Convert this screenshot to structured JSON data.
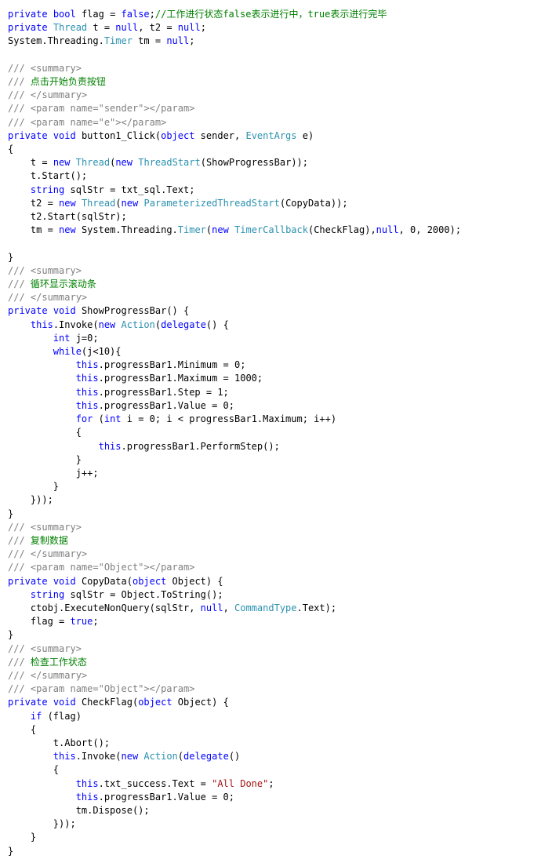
{
  "editor": {
    "language": "csharp",
    "background": "#ffffff",
    "colors": {
      "keyword": "#0000ff",
      "type": "#2b91af",
      "string": "#a31515",
      "comment": "#008000",
      "doc_comment": "#808080",
      "plain": "#000000"
    }
  },
  "code": {
    "lines": [
      {
        "indent": 0,
        "tokens": [
          {
            "t": "kw",
            "s": "private"
          },
          {
            "t": "plain",
            "s": " "
          },
          {
            "t": "kw",
            "s": "bool"
          },
          {
            "t": "plain",
            "s": " flag = "
          },
          {
            "t": "kw",
            "s": "false"
          },
          {
            "t": "plain",
            "s": ";"
          },
          {
            "t": "cmt",
            "s": "//工作进行状态false表示进行中，true表示进行完毕"
          }
        ]
      },
      {
        "indent": 0,
        "tokens": [
          {
            "t": "kw",
            "s": "private"
          },
          {
            "t": "plain",
            "s": " "
          },
          {
            "t": "type",
            "s": "Thread"
          },
          {
            "t": "plain",
            "s": " t = "
          },
          {
            "t": "kw",
            "s": "null"
          },
          {
            "t": "plain",
            "s": ", t2 = "
          },
          {
            "t": "kw",
            "s": "null"
          },
          {
            "t": "plain",
            "s": ";"
          }
        ]
      },
      {
        "indent": 0,
        "tokens": [
          {
            "t": "plain",
            "s": "System.Threading."
          },
          {
            "t": "type",
            "s": "Timer"
          },
          {
            "t": "plain",
            "s": " tm = "
          },
          {
            "t": "kw",
            "s": "null"
          },
          {
            "t": "plain",
            "s": ";"
          }
        ]
      },
      {
        "indent": 0,
        "tokens": []
      },
      {
        "indent": 0,
        "tokens": [
          {
            "t": "doc",
            "s": "/// <summary>"
          }
        ]
      },
      {
        "indent": 0,
        "tokens": [
          {
            "t": "doc",
            "s": "/// "
          },
          {
            "t": "cmt",
            "s": "点击开始负责按钮"
          }
        ]
      },
      {
        "indent": 0,
        "tokens": [
          {
            "t": "doc",
            "s": "/// </summary>"
          }
        ]
      },
      {
        "indent": 0,
        "tokens": [
          {
            "t": "doc",
            "s": "/// <param name=\"sender\"></param>"
          }
        ]
      },
      {
        "indent": 0,
        "tokens": [
          {
            "t": "doc",
            "s": "/// <param name=\"e\"></param>"
          }
        ]
      },
      {
        "indent": 0,
        "tokens": [
          {
            "t": "kw",
            "s": "private"
          },
          {
            "t": "plain",
            "s": " "
          },
          {
            "t": "kw",
            "s": "void"
          },
          {
            "t": "plain",
            "s": " button1_Click("
          },
          {
            "t": "kw",
            "s": "object"
          },
          {
            "t": "plain",
            "s": " sender, "
          },
          {
            "t": "type",
            "s": "EventArgs"
          },
          {
            "t": "plain",
            "s": " e)"
          }
        ]
      },
      {
        "indent": 0,
        "tokens": [
          {
            "t": "plain",
            "s": "{"
          }
        ]
      },
      {
        "indent": 1,
        "tokens": [
          {
            "t": "plain",
            "s": "t = "
          },
          {
            "t": "kw",
            "s": "new"
          },
          {
            "t": "plain",
            "s": " "
          },
          {
            "t": "type",
            "s": "Thread"
          },
          {
            "t": "plain",
            "s": "("
          },
          {
            "t": "kw",
            "s": "new"
          },
          {
            "t": "plain",
            "s": " "
          },
          {
            "t": "type",
            "s": "ThreadStart"
          },
          {
            "t": "plain",
            "s": "(ShowProgressBar));"
          }
        ]
      },
      {
        "indent": 1,
        "tokens": [
          {
            "t": "plain",
            "s": "t.Start();"
          }
        ]
      },
      {
        "indent": 1,
        "tokens": [
          {
            "t": "kw",
            "s": "string"
          },
          {
            "t": "plain",
            "s": " sqlStr = txt_sql.Text;"
          }
        ]
      },
      {
        "indent": 1,
        "tokens": [
          {
            "t": "plain",
            "s": "t2 = "
          },
          {
            "t": "kw",
            "s": "new"
          },
          {
            "t": "plain",
            "s": " "
          },
          {
            "t": "type",
            "s": "Thread"
          },
          {
            "t": "plain",
            "s": "("
          },
          {
            "t": "kw",
            "s": "new"
          },
          {
            "t": "plain",
            "s": " "
          },
          {
            "t": "type",
            "s": "ParameterizedThreadStart"
          },
          {
            "t": "plain",
            "s": "(CopyData));"
          }
        ]
      },
      {
        "indent": 1,
        "tokens": [
          {
            "t": "plain",
            "s": "t2.Start(sqlStr);"
          }
        ]
      },
      {
        "indent": 1,
        "tokens": [
          {
            "t": "plain",
            "s": "tm = "
          },
          {
            "t": "kw",
            "s": "new"
          },
          {
            "t": "plain",
            "s": " System.Threading."
          },
          {
            "t": "type",
            "s": "Timer"
          },
          {
            "t": "plain",
            "s": "("
          },
          {
            "t": "kw",
            "s": "new"
          },
          {
            "t": "plain",
            "s": " "
          },
          {
            "t": "type",
            "s": "TimerCallback"
          },
          {
            "t": "plain",
            "s": "(CheckFlag),"
          },
          {
            "t": "kw",
            "s": "null"
          },
          {
            "t": "plain",
            "s": ", 0, 2000);"
          }
        ]
      },
      {
        "indent": 0,
        "tokens": []
      },
      {
        "indent": 0,
        "tokens": [
          {
            "t": "plain",
            "s": "}"
          }
        ]
      },
      {
        "indent": 0,
        "tokens": [
          {
            "t": "doc",
            "s": "/// <summary>"
          }
        ]
      },
      {
        "indent": 0,
        "tokens": [
          {
            "t": "doc",
            "s": "/// "
          },
          {
            "t": "cmt",
            "s": "循环显示滚动条"
          }
        ]
      },
      {
        "indent": 0,
        "tokens": [
          {
            "t": "doc",
            "s": "/// </summary>"
          }
        ]
      },
      {
        "indent": 0,
        "tokens": [
          {
            "t": "kw",
            "s": "private"
          },
          {
            "t": "plain",
            "s": " "
          },
          {
            "t": "kw",
            "s": "void"
          },
          {
            "t": "plain",
            "s": " ShowProgressBar() {"
          }
        ]
      },
      {
        "indent": 1,
        "tokens": [
          {
            "t": "kw",
            "s": "this"
          },
          {
            "t": "plain",
            "s": ".Invoke("
          },
          {
            "t": "kw",
            "s": "new"
          },
          {
            "t": "plain",
            "s": " "
          },
          {
            "t": "type",
            "s": "Action"
          },
          {
            "t": "plain",
            "s": "("
          },
          {
            "t": "kw",
            "s": "delegate"
          },
          {
            "t": "plain",
            "s": "() {"
          }
        ]
      },
      {
        "indent": 2,
        "tokens": [
          {
            "t": "kw",
            "s": "int"
          },
          {
            "t": "plain",
            "s": " j=0;"
          }
        ]
      },
      {
        "indent": 2,
        "tokens": [
          {
            "t": "kw",
            "s": "while"
          },
          {
            "t": "plain",
            "s": "(j<10){"
          }
        ]
      },
      {
        "indent": 3,
        "tokens": [
          {
            "t": "kw",
            "s": "this"
          },
          {
            "t": "plain",
            "s": ".progressBar1.Minimum = 0;"
          }
        ]
      },
      {
        "indent": 3,
        "tokens": [
          {
            "t": "kw",
            "s": "this"
          },
          {
            "t": "plain",
            "s": ".progressBar1.Maximum = 1000;"
          }
        ]
      },
      {
        "indent": 3,
        "tokens": [
          {
            "t": "kw",
            "s": "this"
          },
          {
            "t": "plain",
            "s": ".progressBar1.Step = 1;"
          }
        ]
      },
      {
        "indent": 3,
        "tokens": [
          {
            "t": "kw",
            "s": "this"
          },
          {
            "t": "plain",
            "s": ".progressBar1.Value = 0;"
          }
        ]
      },
      {
        "indent": 3,
        "tokens": [
          {
            "t": "kw",
            "s": "for"
          },
          {
            "t": "plain",
            "s": " ("
          },
          {
            "t": "kw",
            "s": "int"
          },
          {
            "t": "plain",
            "s": " i = 0; i < progressBar1.Maximum; i++)"
          }
        ]
      },
      {
        "indent": 3,
        "tokens": [
          {
            "t": "plain",
            "s": "{"
          }
        ]
      },
      {
        "indent": 4,
        "tokens": [
          {
            "t": "kw",
            "s": "this"
          },
          {
            "t": "plain",
            "s": ".progressBar1.PerformStep();"
          }
        ]
      },
      {
        "indent": 3,
        "tokens": [
          {
            "t": "plain",
            "s": "}"
          }
        ]
      },
      {
        "indent": 3,
        "tokens": [
          {
            "t": "plain",
            "s": "j++;"
          }
        ]
      },
      {
        "indent": 2,
        "tokens": [
          {
            "t": "plain",
            "s": "}"
          }
        ]
      },
      {
        "indent": 1,
        "tokens": [
          {
            "t": "plain",
            "s": "}));"
          }
        ]
      },
      {
        "indent": 0,
        "tokens": [
          {
            "t": "plain",
            "s": "}"
          }
        ]
      },
      {
        "indent": 0,
        "tokens": [
          {
            "t": "doc",
            "s": "/// <summary>"
          }
        ]
      },
      {
        "indent": 0,
        "tokens": [
          {
            "t": "doc",
            "s": "/// "
          },
          {
            "t": "cmt",
            "s": "复制数据"
          }
        ]
      },
      {
        "indent": 0,
        "tokens": [
          {
            "t": "doc",
            "s": "/// </summary>"
          }
        ]
      },
      {
        "indent": 0,
        "tokens": [
          {
            "t": "doc",
            "s": "/// <param name=\"Object\"></param>"
          }
        ]
      },
      {
        "indent": 0,
        "tokens": [
          {
            "t": "kw",
            "s": "private"
          },
          {
            "t": "plain",
            "s": " "
          },
          {
            "t": "kw",
            "s": "void"
          },
          {
            "t": "plain",
            "s": " CopyData("
          },
          {
            "t": "kw",
            "s": "object"
          },
          {
            "t": "plain",
            "s": " Object) {"
          }
        ]
      },
      {
        "indent": 1,
        "tokens": [
          {
            "t": "kw",
            "s": "string"
          },
          {
            "t": "plain",
            "s": " sqlStr = Object.ToString();"
          }
        ]
      },
      {
        "indent": 1,
        "tokens": [
          {
            "t": "plain",
            "s": "ctobj.ExecuteNonQuery(sqlStr, "
          },
          {
            "t": "kw",
            "s": "null"
          },
          {
            "t": "plain",
            "s": ", "
          },
          {
            "t": "type",
            "s": "CommandType"
          },
          {
            "t": "plain",
            "s": ".Text);"
          }
        ]
      },
      {
        "indent": 1,
        "tokens": [
          {
            "t": "plain",
            "s": "flag = "
          },
          {
            "t": "kw",
            "s": "true"
          },
          {
            "t": "plain",
            "s": ";"
          }
        ]
      },
      {
        "indent": 0,
        "tokens": [
          {
            "t": "plain",
            "s": "}"
          }
        ]
      },
      {
        "indent": 0,
        "tokens": [
          {
            "t": "doc",
            "s": "/// <summary>"
          }
        ]
      },
      {
        "indent": 0,
        "tokens": [
          {
            "t": "doc",
            "s": "/// "
          },
          {
            "t": "cmt",
            "s": "检查工作状态"
          }
        ]
      },
      {
        "indent": 0,
        "tokens": [
          {
            "t": "doc",
            "s": "/// </summary>"
          }
        ]
      },
      {
        "indent": 0,
        "tokens": [
          {
            "t": "doc",
            "s": "/// <param name=\"Object\"></param>"
          }
        ]
      },
      {
        "indent": 0,
        "tokens": [
          {
            "t": "kw",
            "s": "private"
          },
          {
            "t": "plain",
            "s": " "
          },
          {
            "t": "kw",
            "s": "void"
          },
          {
            "t": "plain",
            "s": " CheckFlag("
          },
          {
            "t": "kw",
            "s": "object"
          },
          {
            "t": "plain",
            "s": " Object) {"
          }
        ]
      },
      {
        "indent": 1,
        "tokens": [
          {
            "t": "kw",
            "s": "if"
          },
          {
            "t": "plain",
            "s": " (flag)"
          }
        ]
      },
      {
        "indent": 1,
        "tokens": [
          {
            "t": "plain",
            "s": "{"
          }
        ]
      },
      {
        "indent": 2,
        "tokens": [
          {
            "t": "plain",
            "s": "t.Abort();"
          }
        ]
      },
      {
        "indent": 2,
        "tokens": [
          {
            "t": "kw",
            "s": "this"
          },
          {
            "t": "plain",
            "s": ".Invoke("
          },
          {
            "t": "kw",
            "s": "new"
          },
          {
            "t": "plain",
            "s": " "
          },
          {
            "t": "type",
            "s": "Action"
          },
          {
            "t": "plain",
            "s": "("
          },
          {
            "t": "kw",
            "s": "delegate"
          },
          {
            "t": "plain",
            "s": "()"
          }
        ]
      },
      {
        "indent": 2,
        "tokens": [
          {
            "t": "plain",
            "s": "{"
          }
        ]
      },
      {
        "indent": 3,
        "tokens": [
          {
            "t": "kw",
            "s": "this"
          },
          {
            "t": "plain",
            "s": ".txt_success.Text = "
          },
          {
            "t": "str",
            "s": "\"All Done\""
          },
          {
            "t": "plain",
            "s": ";"
          }
        ]
      },
      {
        "indent": 3,
        "tokens": [
          {
            "t": "kw",
            "s": "this"
          },
          {
            "t": "plain",
            "s": ".progressBar1.Value = 0;"
          }
        ]
      },
      {
        "indent": 3,
        "tokens": [
          {
            "t": "plain",
            "s": "tm.Dispose();"
          }
        ]
      },
      {
        "indent": 2,
        "tokens": [
          {
            "t": "plain",
            "s": "}));"
          }
        ]
      },
      {
        "indent": 1,
        "tokens": [
          {
            "t": "plain",
            "s": "}"
          }
        ]
      },
      {
        "indent": 0,
        "tokens": [
          {
            "t": "plain",
            "s": "}"
          }
        ]
      }
    ]
  }
}
